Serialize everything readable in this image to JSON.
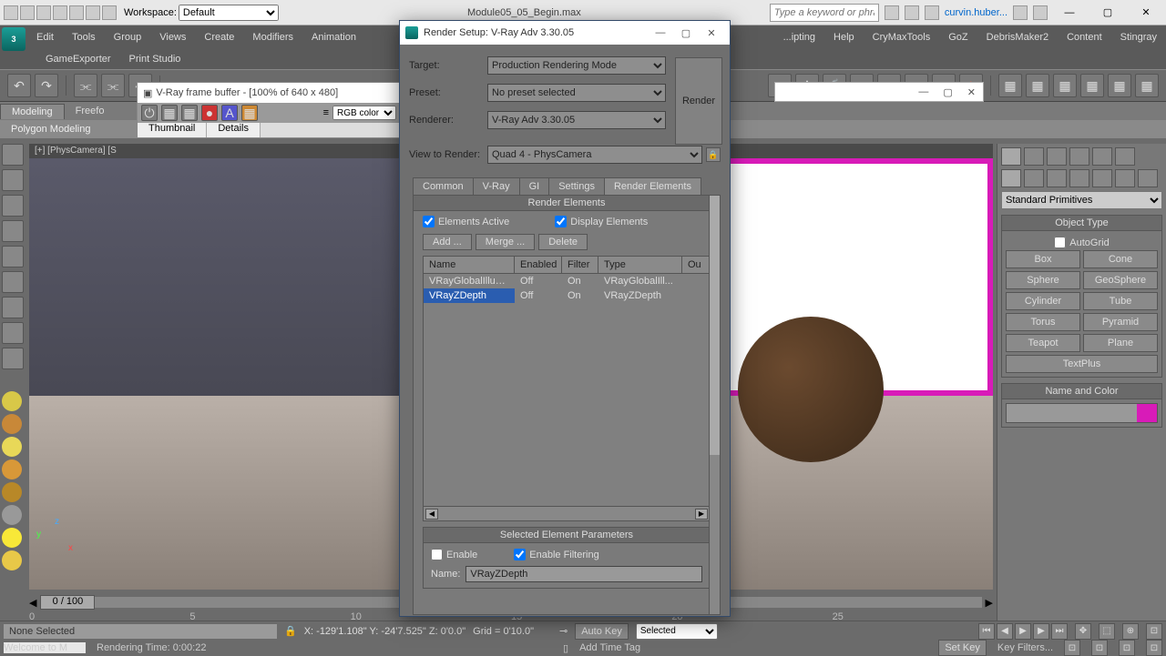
{
  "titlebar": {
    "workspace_label": "Workspace:",
    "workspace_value": "Default",
    "doc": "Module05_05_Begin.max",
    "search_placeholder": "Type a keyword or phrase",
    "signin": "curvin.huber..."
  },
  "menu": [
    "Edit",
    "Tools",
    "Group",
    "Views",
    "Create",
    "Modifiers",
    "Animation",
    "...ipting",
    "Help",
    "CryMaxTools",
    "GoZ",
    "DebrisMaker2",
    "Content",
    "Stingray"
  ],
  "menu2": [
    "GameExporter",
    "Print Studio"
  ],
  "ribbon": {
    "tab1": "Modeling",
    "tab2": "Freefo",
    "panel": "Polygon Modeling"
  },
  "framebuffer": {
    "title": "V-Ray frame buffer - [100% of 640 x 480]",
    "tab1": "Thumbnail",
    "tab2": "Details",
    "channel": "RGB color"
  },
  "viewport_label": "[+] [PhysCamera] [S",
  "axis": {
    "x": "x",
    "y": "y",
    "z": "z"
  },
  "render_setup": {
    "title": "Render Setup: V-Ray Adv 3.30.05",
    "labels": {
      "target": "Target:",
      "preset": "Preset:",
      "renderer": "Renderer:",
      "view": "View to Render:"
    },
    "target": "Production Rendering Mode",
    "preset": "No preset selected",
    "renderer": "V-Ray Adv 3.30.05",
    "view": "Quad 4 - PhysCamera",
    "render_btn": "Render",
    "tabs": [
      "Common",
      "V-Ray",
      "GI",
      "Settings",
      "Render Elements"
    ],
    "rollout": "Render Elements",
    "chk_active": "Elements Active",
    "chk_display": "Display Elements",
    "btn_add": "Add ...",
    "btn_merge": "Merge ...",
    "btn_delete": "Delete",
    "cols": {
      "name": "Name",
      "enabled": "Enabled",
      "filter": "Filter",
      "type": "Type",
      "out": "Ou"
    },
    "rows": [
      {
        "name": "VRayGlobalIllumi...",
        "enabled": "Off",
        "filter": "On",
        "type": "VRayGlobalIll..."
      },
      {
        "name": "VRayZDepth",
        "enabled": "Off",
        "filter": "On",
        "type": "VRayZDepth"
      }
    ],
    "sel_params": "Selected Element Parameters",
    "chk_enable": "Enable",
    "chk_filtering": "Enable Filtering",
    "name_label": "Name:",
    "name_value": "VRayZDepth"
  },
  "rpanel": {
    "category": "Standard Primitives",
    "ot_head": "Object Type",
    "autogrid": "AutoGrid",
    "btns": [
      "Box",
      "Cone",
      "Sphere",
      "GeoSphere",
      "Cylinder",
      "Tube",
      "Torus",
      "Pyramid",
      "Teapot",
      "Plane",
      "TextPlus"
    ],
    "nc_head": "Name and Color"
  },
  "timeline": {
    "pos": "0 / 100",
    "marks": [
      "0",
      "5",
      "10",
      "15",
      "20",
      "25"
    ]
  },
  "status": {
    "sel": "None Selected",
    "coords": "X: -129'1.108\"  Y: -24'7.525\"  Z: 0'0.0\"",
    "grid": "Grid = 0'10.0\"",
    "autokey": "Auto Key",
    "setkey": "Set Key",
    "kf_mode": "Selected",
    "kf_filters": "Key Filters...",
    "addtag": "Add Time Tag",
    "welcome": "Welcome to M",
    "rtime": "Rendering Time: 0:00:22"
  }
}
